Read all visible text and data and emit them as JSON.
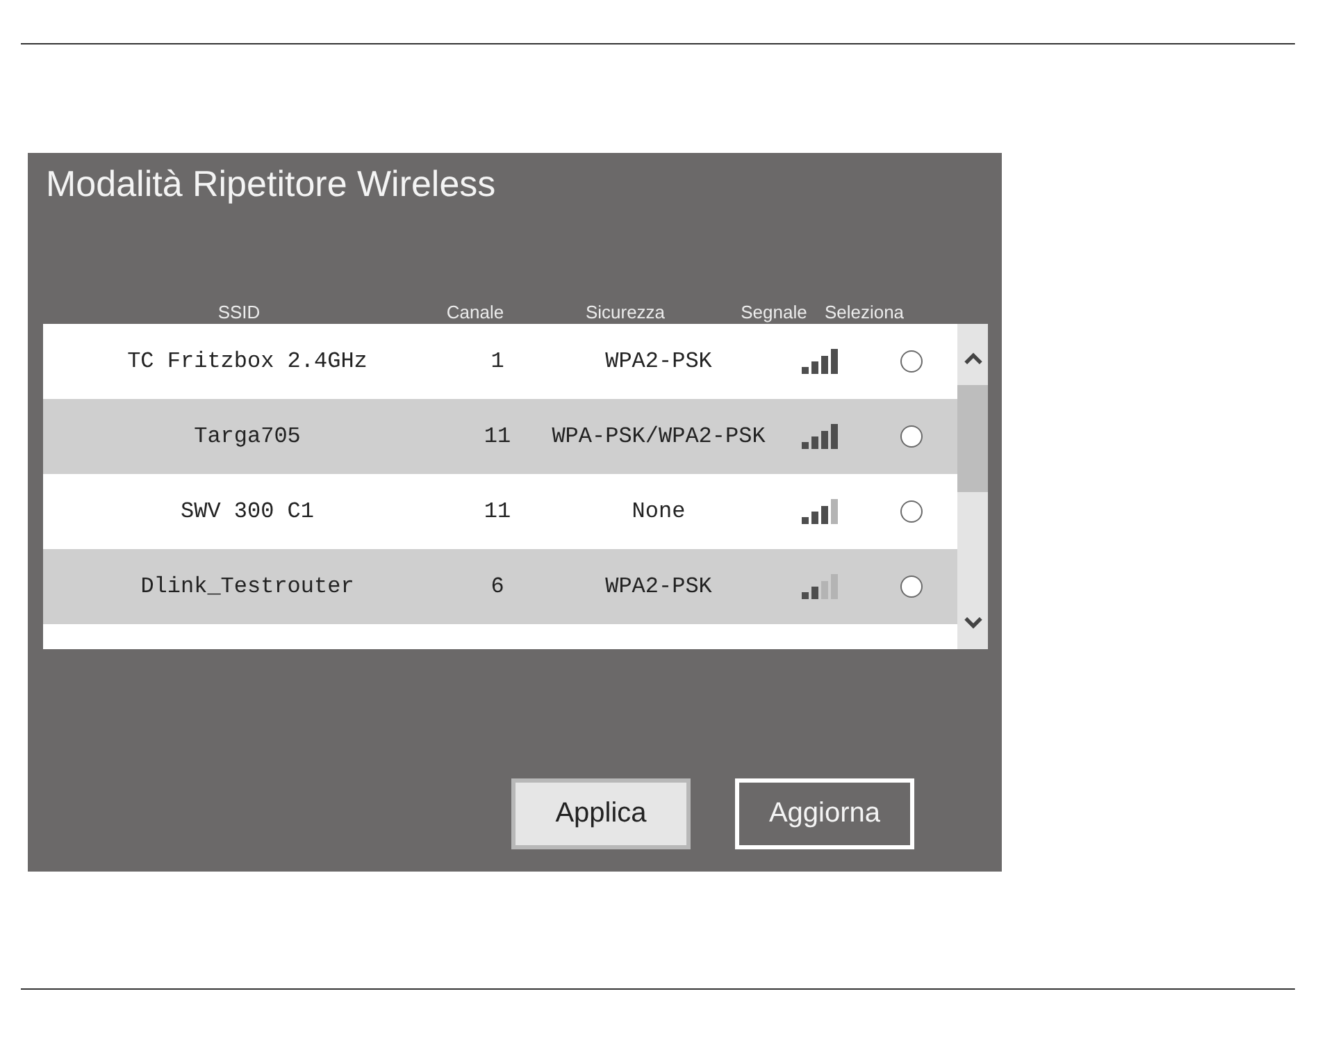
{
  "dialog": {
    "title": "Modalità Ripetitore Wireless"
  },
  "table": {
    "columns": [
      "SSID",
      "Canale",
      "Sicurezza",
      "Segnale",
      "Seleziona"
    ],
    "rows": [
      {
        "ssid": "TC Fritzbox 2.4GHz",
        "channel": "1",
        "security": "WPA2-PSK",
        "signal_bars": [
          {
            "on": true
          },
          {
            "on": true
          },
          {
            "on": true
          },
          {
            "on": true
          }
        ],
        "selected": false
      },
      {
        "ssid": "Targa705",
        "channel": "11",
        "security": "WPA-PSK/WPA2-PSK",
        "signal_bars": [
          {
            "on": true
          },
          {
            "on": true
          },
          {
            "on": true
          },
          {
            "on": true
          }
        ],
        "selected": false
      },
      {
        "ssid": "SWV 300 C1",
        "channel": "11",
        "security": "None",
        "signal_bars": [
          {
            "on": true
          },
          {
            "on": true
          },
          {
            "on": true
          },
          {
            "on": false
          }
        ],
        "selected": false
      },
      {
        "ssid": "Dlink_Testrouter",
        "channel": "6",
        "security": "WPA2-PSK",
        "signal_bars": [
          {
            "on": true
          },
          {
            "on": true
          },
          {
            "on": false
          },
          {
            "on": false
          }
        ],
        "selected": false
      }
    ]
  },
  "buttons": [
    {
      "label": "Applica",
      "kind": "filled"
    },
    {
      "label": "Aggiorna",
      "kind": "outlined"
    }
  ]
}
